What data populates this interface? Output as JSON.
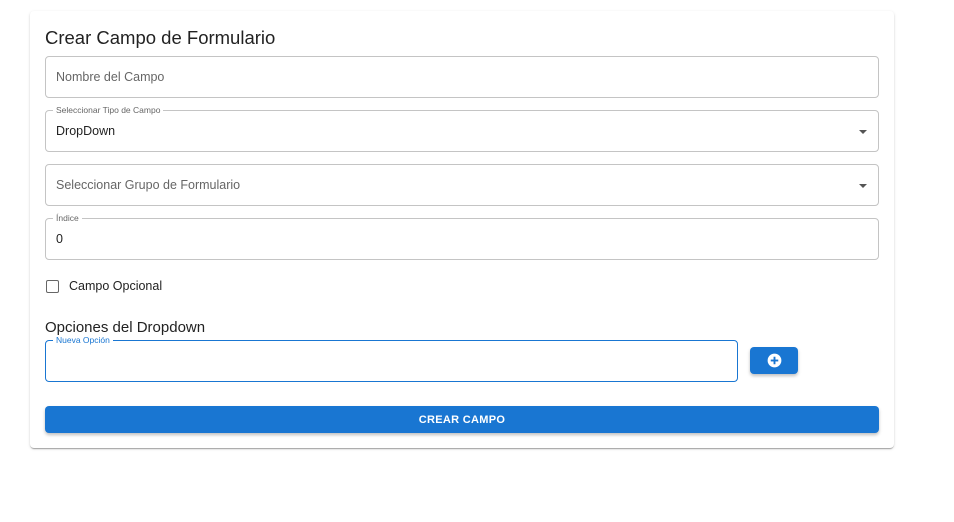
{
  "form": {
    "title": "Crear Campo de Formulario",
    "name_field": {
      "placeholder": "Nombre del Campo"
    },
    "type_field": {
      "label": "Seleccionar Tipo de Campo",
      "value": "DropDown"
    },
    "group_field": {
      "placeholder": "Seleccionar Grupo de Formulario"
    },
    "index_field": {
      "label": "Índice",
      "value": "0"
    },
    "optional_checkbox": {
      "label": "Campo Opcional",
      "checked": false
    },
    "dropdown_section": {
      "title": "Opciones del Dropdown",
      "new_option_field": {
        "label": "Nueva Opción",
        "value": ""
      },
      "add_button_icon": "plus-circle-icon"
    },
    "submit_label": "CREAR CAMPO"
  },
  "colors": {
    "primary": "#1976d2",
    "border": "#c4c4c4",
    "text": "#222222"
  }
}
